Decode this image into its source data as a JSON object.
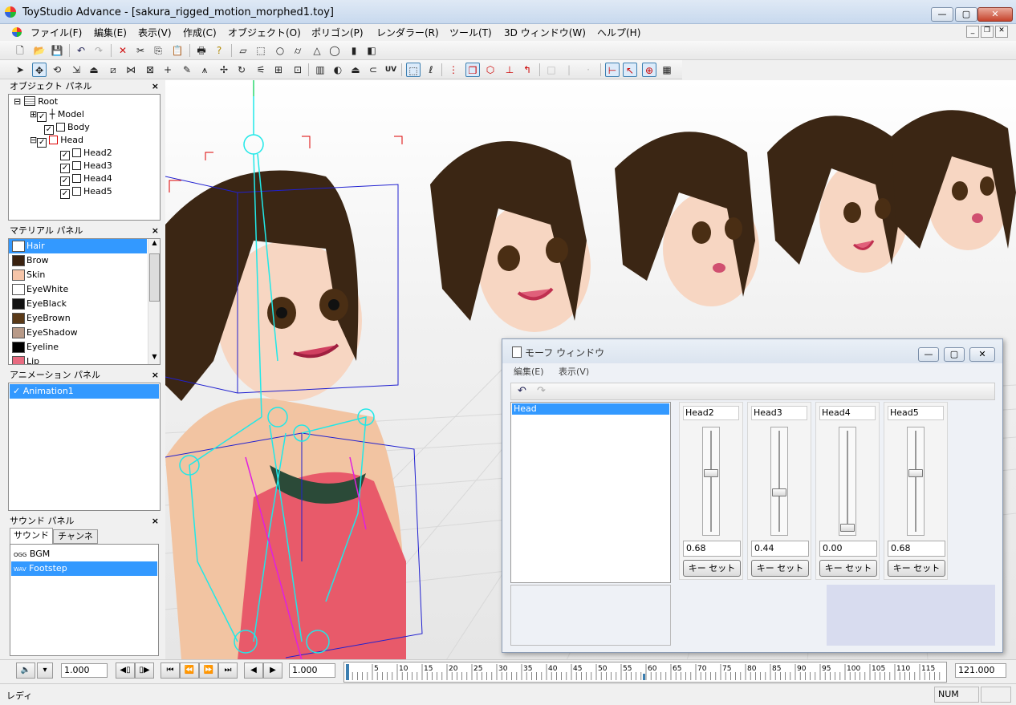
{
  "window": {
    "title": "ToyStudio Advance - [sakura_rigged_motion_morphed1.toy]",
    "minimize": "—",
    "maximize": "▢",
    "close": "✕"
  },
  "menu": [
    "ファイル(F)",
    "編集(E)",
    "表示(V)",
    "作成(C)",
    "オブジェクト(O)",
    "ポリゴン(P)",
    "レンダラー(R)",
    "ツール(T)",
    "3D ウィンドウ(W)",
    "ヘルプ(H)"
  ],
  "toolbar1": [
    "new-icon",
    "open-icon",
    "save-icon",
    "undo-icon",
    "redo-icon",
    "delete-icon",
    "cut-icon",
    "copy-icon",
    "paste-icon",
    "print-icon",
    "help-icon",
    "plane-icon",
    "box-icon",
    "circle-icon",
    "cylinder-icon",
    "cone-icon",
    "torus-icon",
    "bar-icon",
    "extrude-icon"
  ],
  "toolbar2_uv": "UV",
  "object_panel": {
    "title": "オブジェクト パネル",
    "close": "×",
    "nodes": [
      {
        "label": "Root",
        "depth": 0,
        "expander": "⊟",
        "checked": false,
        "icon": "root-icon"
      },
      {
        "label": "Model",
        "depth": 1,
        "expander": "⊞",
        "checked": true,
        "icon": "bone-icon"
      },
      {
        "label": "Body",
        "depth": 1,
        "expander": "",
        "checked": true,
        "icon": "cube-icon"
      },
      {
        "label": "Head",
        "depth": 1,
        "expander": "⊟",
        "checked": true,
        "icon": "cube-icon",
        "red": true
      },
      {
        "label": "Head2",
        "depth": 2,
        "expander": "",
        "checked": true,
        "icon": "cube-icon"
      },
      {
        "label": "Head3",
        "depth": 2,
        "expander": "",
        "checked": true,
        "icon": "cube-icon"
      },
      {
        "label": "Head4",
        "depth": 2,
        "expander": "",
        "checked": true,
        "icon": "cube-icon"
      },
      {
        "label": "Head5",
        "depth": 2,
        "expander": "",
        "checked": true,
        "icon": "cube-icon"
      }
    ]
  },
  "material_panel": {
    "title": "マテリアル パネル",
    "close": "×",
    "items": [
      {
        "name": "Hair",
        "color": "#ffffff",
        "selected": true
      },
      {
        "name": "Brow",
        "color": "#3a2210"
      },
      {
        "name": "Skin",
        "color": "#f5c4a8"
      },
      {
        "name": "EyeWhite",
        "color": "#ffffff"
      },
      {
        "name": "EyeBlack",
        "color": "#111111"
      },
      {
        "name": "EyeBrown",
        "color": "#5a3a18"
      },
      {
        "name": "EyeShadow",
        "color": "#b89a88"
      },
      {
        "name": "Eyeline",
        "color": "#000000"
      },
      {
        "name": "Lip",
        "color": "#e86b80"
      }
    ]
  },
  "animation_panel": {
    "title": "アニメーション パネル",
    "close": "×",
    "items": [
      {
        "name": "Animation1",
        "check": "✓"
      }
    ]
  },
  "sound_panel": {
    "title": "サウンド パネル",
    "close": "×",
    "tabs": [
      "サウンド",
      "チャンネル"
    ],
    "items": [
      {
        "type": "OGG",
        "name": "BGM"
      },
      {
        "type": "WAV",
        "name": "Footstep",
        "selected": true
      }
    ]
  },
  "morph_window": {
    "title": "モーフ ウィンドウ",
    "menu": [
      "編集(E)",
      "表示(V)"
    ],
    "list": [
      "Head"
    ],
    "sliders": [
      {
        "name": "Head2",
        "value": "0.68",
        "fraction": 0.68
      },
      {
        "name": "Head3",
        "value": "0.44",
        "fraction": 0.44
      },
      {
        "name": "Head4",
        "value": "0.00",
        "fraction": 0.0
      },
      {
        "name": "Head5",
        "value": "0.68",
        "fraction": 0.68
      }
    ],
    "key_label": "キー セット"
  },
  "timeline": {
    "speed": "1.000",
    "frame": "1.000",
    "end": "121.000",
    "ticks": [
      "5",
      "10",
      "15",
      "20",
      "25",
      "30",
      "35",
      "40",
      "45",
      "50",
      "55",
      "60",
      "65",
      "70",
      "75",
      "80",
      "85",
      "90",
      "95",
      "100",
      "105",
      "110",
      "115"
    ]
  },
  "status": {
    "text": "レディ",
    "num": "NUM"
  }
}
